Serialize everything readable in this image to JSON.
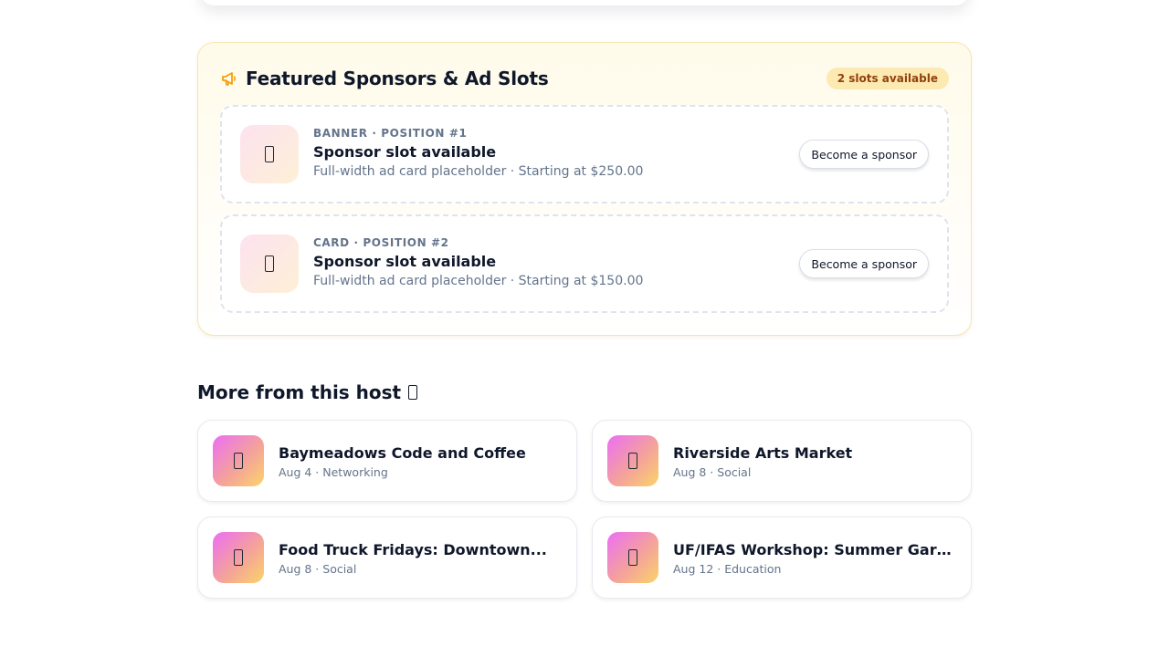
{
  "sponsors": {
    "title": "Featured Sponsors & Ad Slots",
    "title_icon": "megaphone-icon",
    "badge": "2 slots available",
    "accent_color": "#f59e0b",
    "slots": [
      {
        "kicker": "BANNER · POSITION #1",
        "title": "Sponsor slot available",
        "subtitle": "Full-width ad card placeholder · Starting at $250.00",
        "button": "Become a sponsor"
      },
      {
        "kicker": "CARD · POSITION #2",
        "title": "Sponsor slot available",
        "subtitle": "Full-width ad card placeholder · Starting at $150.00",
        "button": "Become a sponsor"
      }
    ]
  },
  "more_from_host": {
    "title": "More from this host",
    "events": [
      {
        "title": "Baymeadows Code and Coffee",
        "meta": "Aug 4 · Networking"
      },
      {
        "title": "Riverside Arts Market",
        "meta": "Aug 8 · Social"
      },
      {
        "title": "Food Truck Fridays: Downtown...",
        "meta": "Aug 8 · Social"
      },
      {
        "title": "UF/IFAS Workshop: Summer Gardenin...",
        "meta": "Aug 12 · Education"
      }
    ]
  }
}
